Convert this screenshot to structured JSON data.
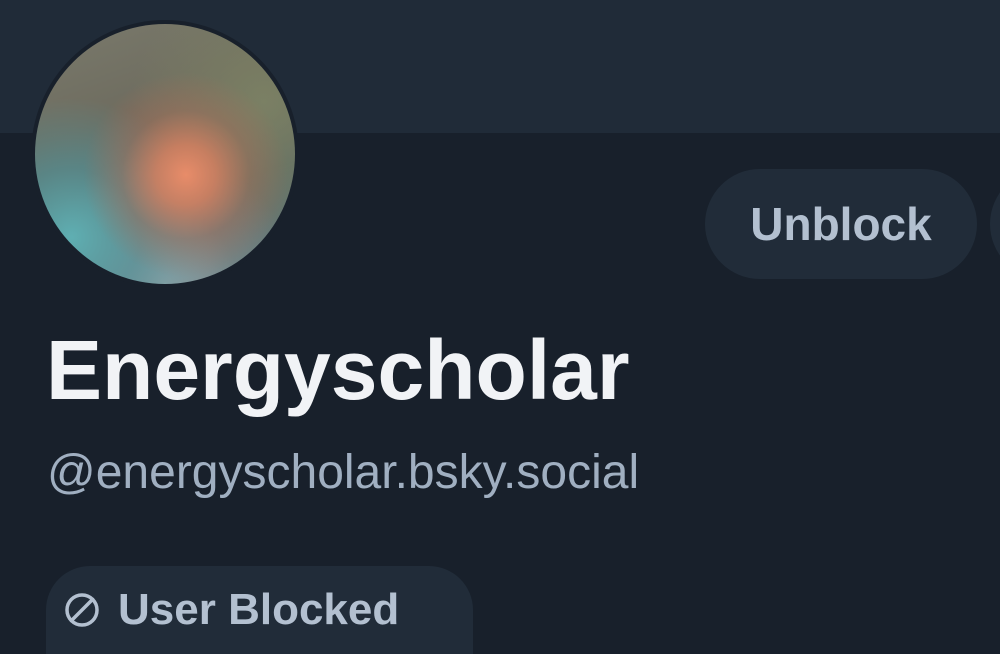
{
  "profile": {
    "display_name": "Energyscholar",
    "handle": "@energyscholar.bsky.social"
  },
  "actions": {
    "unblock_label": "Unblock"
  },
  "status": {
    "label": "User Blocked",
    "icon": "ban-icon"
  },
  "colors": {
    "background": "#18202b",
    "banner": "#202b38",
    "pill": "#212c39",
    "name_text": "#f1f3f6",
    "secondary_text": "#a0afc1",
    "pill_text": "#b3c0d0"
  }
}
